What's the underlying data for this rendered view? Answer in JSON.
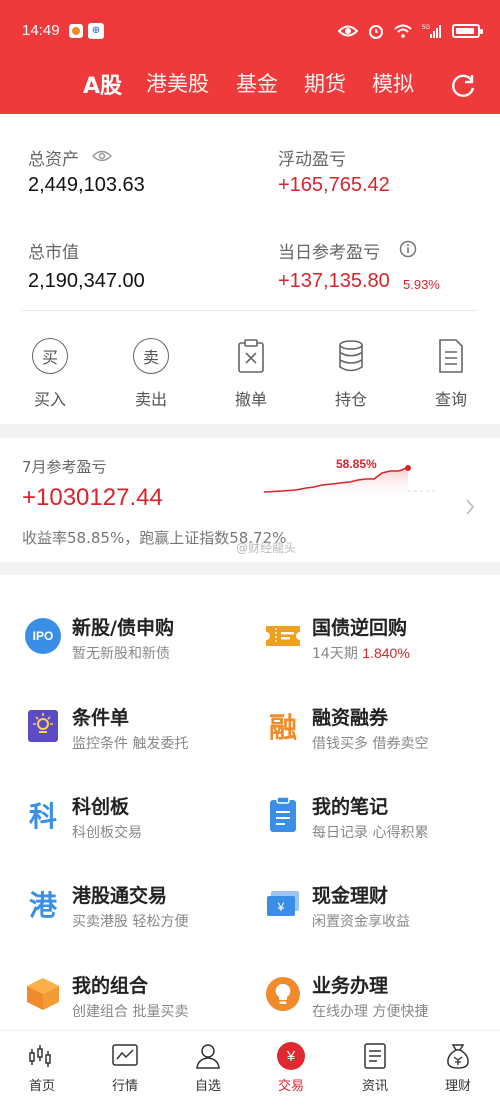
{
  "status_bar": {
    "time": "14:49",
    "network": "5G"
  },
  "tabs": [
    {
      "label": "A股",
      "active": true
    },
    {
      "label": "港美股",
      "active": false
    },
    {
      "label": "基金",
      "active": false
    },
    {
      "label": "期货",
      "active": false
    },
    {
      "label": "模拟",
      "active": false
    }
  ],
  "assets": {
    "total_label": "总资产",
    "total_value": "2,449,103.63",
    "float_label": "浮动盈亏",
    "float_value": "+165,765.42",
    "market_label": "总市值",
    "market_value": "2,190,347.00",
    "daily_label": "当日参考盈亏",
    "daily_value": "+137,135.80",
    "daily_pct": "5.93%"
  },
  "actions": [
    {
      "label": "买入",
      "icon": "buy-icon"
    },
    {
      "label": "卖出",
      "icon": "sell-icon"
    },
    {
      "label": "撤单",
      "icon": "cancel-order-icon"
    },
    {
      "label": "持仓",
      "icon": "holdings-icon"
    },
    {
      "label": "查询",
      "icon": "query-icon"
    }
  ],
  "action_glyphs": {
    "buy": "买",
    "sell": "卖"
  },
  "monthly": {
    "title": "7月参考盈亏",
    "value": "+1030127.44",
    "chart_pct": "58.85%",
    "summary": "收益率58.85%，跑赢上证指数58.72%",
    "watermark": "@财经龍头"
  },
  "services": [
    {
      "title": "新股/债申购",
      "subtitle": "暂无新股和新债",
      "icon": "ipo-icon",
      "icon_text": "IPO"
    },
    {
      "title": "国债逆回购",
      "subtitle": "14天期",
      "subtitle_highlight": "1.840%",
      "icon": "ticket-icon"
    },
    {
      "title": "条件单",
      "subtitle": "监控条件 触发委托",
      "icon": "condition-order-icon"
    },
    {
      "title": "融资融券",
      "subtitle": "借钱买多 借券卖空",
      "icon": "margin-icon",
      "icon_text": "融"
    },
    {
      "title": "科创板",
      "subtitle": "科创板交易",
      "icon": "star-market-icon",
      "icon_text": "科"
    },
    {
      "title": "我的笔记",
      "subtitle": "每日记录 心得积累",
      "icon": "notes-icon"
    },
    {
      "title": "港股通交易",
      "subtitle": "买卖港股 轻松方便",
      "icon": "hk-connect-icon",
      "icon_text": "港"
    },
    {
      "title": "现金理财",
      "subtitle": "闲置资金享收益",
      "icon": "cash-icon",
      "icon_text": "¥"
    },
    {
      "title": "我的组合",
      "subtitle": "创建组合 批量买卖",
      "icon": "portfolio-icon"
    },
    {
      "title": "业务办理",
      "subtitle": "在线办理 方便快捷",
      "icon": "business-icon"
    }
  ],
  "nav": [
    {
      "label": "首页",
      "icon": "home-chart-icon",
      "active": false
    },
    {
      "label": "行情",
      "icon": "market-icon",
      "active": false
    },
    {
      "label": "自选",
      "icon": "watchlist-icon",
      "active": false
    },
    {
      "label": "交易",
      "icon": "trade-icon",
      "active": true,
      "icon_text": "¥"
    },
    {
      "label": "资讯",
      "icon": "news-icon",
      "active": false
    },
    {
      "label": "理财",
      "icon": "wealth-icon",
      "active": false
    }
  ],
  "colors": {
    "brand": "#ef3a3c",
    "profit": "#d8242b",
    "ipo": "#3a8ee6",
    "orange": "#f08a2a",
    "purple": "#5b4bc4"
  }
}
